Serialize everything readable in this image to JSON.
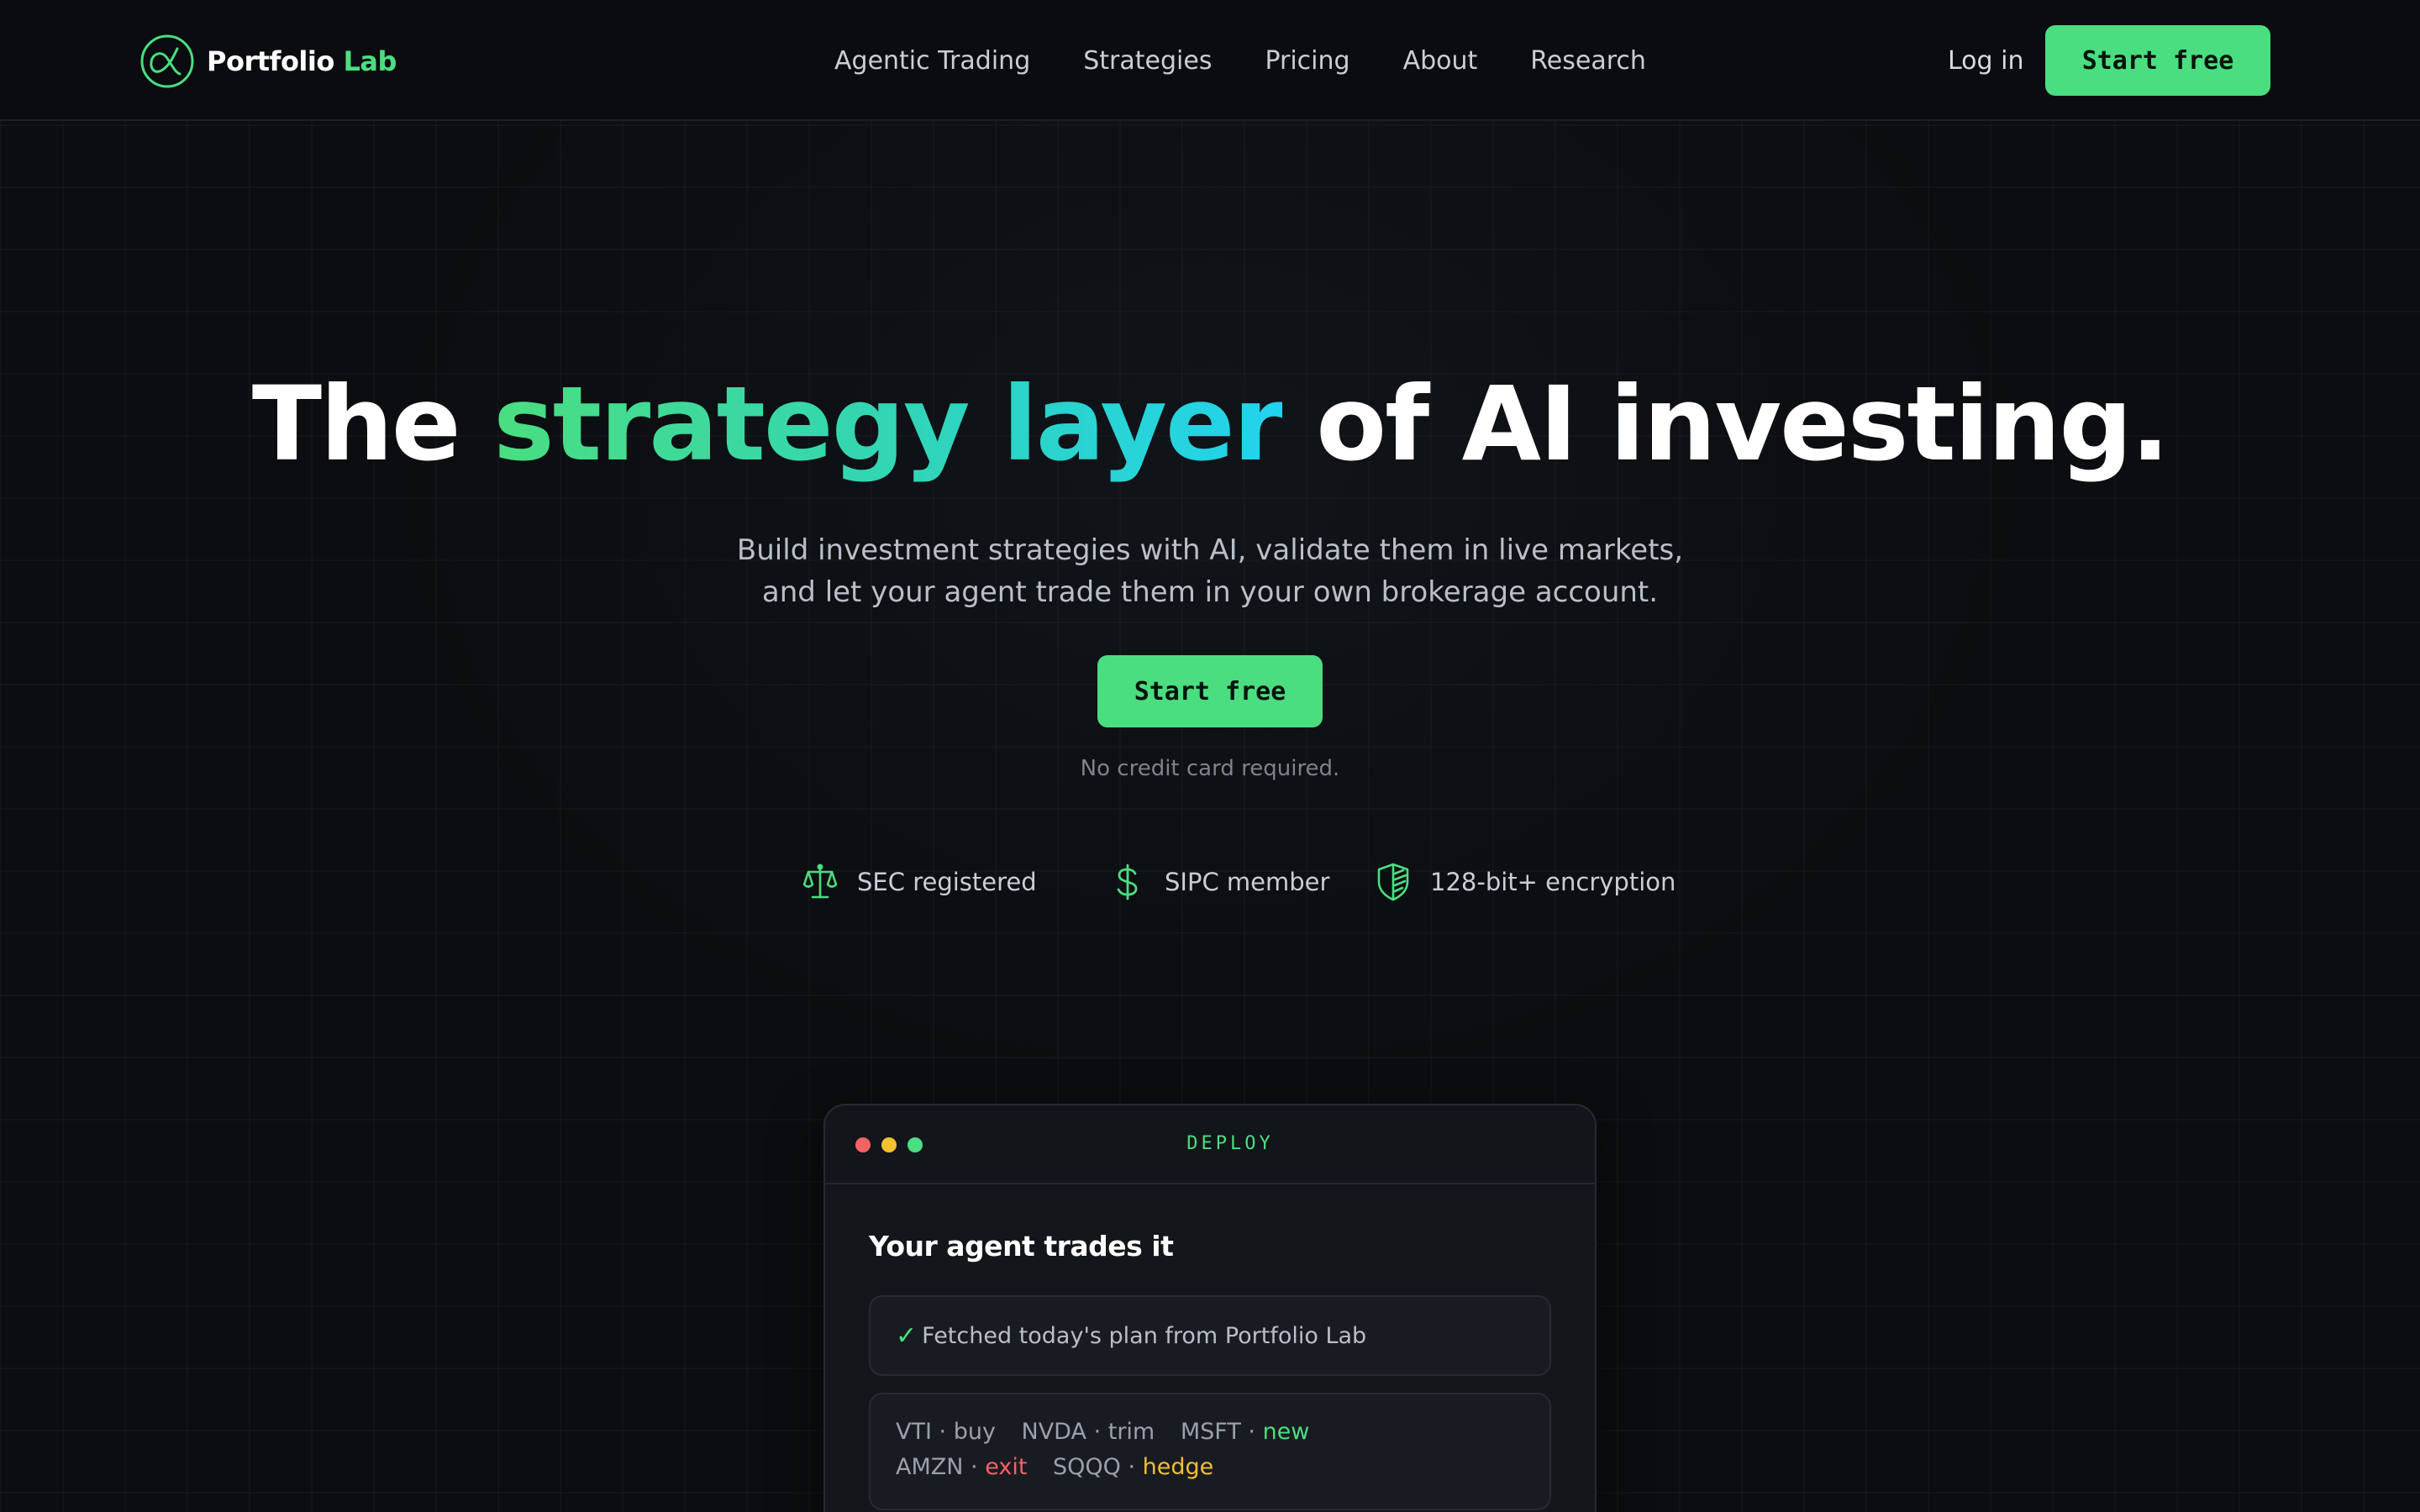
{
  "nav": {
    "brand_name": "Portfolio",
    "brand_accent": "Lab",
    "links": [
      "Agentic Trading",
      "Strategies",
      "Pricing",
      "About",
      "Research"
    ],
    "login": "Log in",
    "cta": "Start free"
  },
  "hero": {
    "title_prefix": "The ",
    "title_highlight": "strategy layer",
    "title_suffix": " of AI investing.",
    "subtitle_line1": "Build investment strategies with AI, validate them in live markets,",
    "subtitle_line2": "and let your agent trade them in your own brokerage account.",
    "cta": "Start free",
    "note": "No credit card required."
  },
  "badges": [
    {
      "icon": "scale-icon",
      "label": "SEC registered"
    },
    {
      "icon": "dollar-icon",
      "label": "SIPC member"
    },
    {
      "icon": "shield-icon",
      "label": "128-bit+ encryption"
    }
  ],
  "deploy_card": {
    "tag": "DEPLOY",
    "title": "Your agent trades it",
    "status_check": "✓",
    "status_text": "Fetched today's plan from Portfolio Lab",
    "trades_line1": [
      {
        "ticker": "VTI",
        "sep": " · ",
        "action": "buy",
        "tone": "neutral"
      },
      {
        "ticker": "NVDA",
        "sep": " · ",
        "action": "trim",
        "tone": "neutral"
      },
      {
        "ticker": "MSFT",
        "sep": " · ",
        "action": "new",
        "tone": "green"
      }
    ],
    "trades_line2": [
      {
        "ticker": "AMZN",
        "sep": " · ",
        "action": "exit",
        "tone": "red"
      },
      {
        "ticker": "SQQQ",
        "sep": " · ",
        "action": "hedge",
        "tone": "yellow"
      }
    ]
  },
  "colors": {
    "background": "#0b0d10",
    "accent_green": "#4ade80",
    "accent_teal": "#2dd4bf",
    "accent_cyan": "#22d3ee",
    "red": "#f26363",
    "yellow": "#f5bf2e"
  }
}
